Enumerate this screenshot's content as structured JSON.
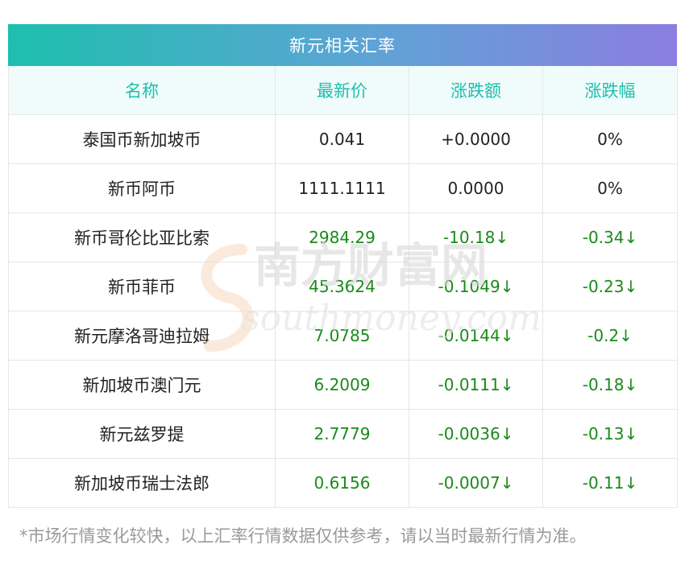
{
  "title": "新元相关汇率",
  "columns": [
    "名称",
    "最新价",
    "涨跌额",
    "涨跌幅"
  ],
  "rows": [
    {
      "name": "泰国币新加坡币",
      "price": "0.041",
      "change": "+0.0000",
      "pct": "0%",
      "trend": "flat"
    },
    {
      "name": "新币阿币",
      "price": "1111.1111",
      "change": "0.0000",
      "pct": "0%",
      "trend": "flat"
    },
    {
      "name": "新币哥伦比亚比索",
      "price": "2984.29",
      "change": "-10.18↓",
      "pct": "-0.34↓",
      "trend": "down"
    },
    {
      "name": "新币菲币",
      "price": "45.3624",
      "change": "-0.1049↓",
      "pct": "-0.23↓",
      "trend": "down"
    },
    {
      "name": "新元摩洛哥迪拉姆",
      "price": "7.0785",
      "change": "-0.0144↓",
      "pct": "-0.2↓",
      "trend": "down"
    },
    {
      "name": "新加坡币澳门元",
      "price": "6.2009",
      "change": "-0.0111↓",
      "pct": "-0.18↓",
      "trend": "down"
    },
    {
      "name": "新元兹罗提",
      "price": "2.7779",
      "change": "-0.0036↓",
      "pct": "-0.13↓",
      "trend": "down"
    },
    {
      "name": "新加坡币瑞士法郎",
      "price": "0.6156",
      "change": "-0.0007↓",
      "pct": "-0.11↓",
      "trend": "down"
    }
  ],
  "footnote": "*市场行情变化较快，以上汇率行情数据仅供参考，请以当时最新行情为准。",
  "watermark": {
    "cn": "南方财富网",
    "en": "southmoney.com"
  },
  "colors": {
    "accent": "#1dbfad",
    "gradient_end": "#8b7de0",
    "down": "#1a8a1a"
  }
}
